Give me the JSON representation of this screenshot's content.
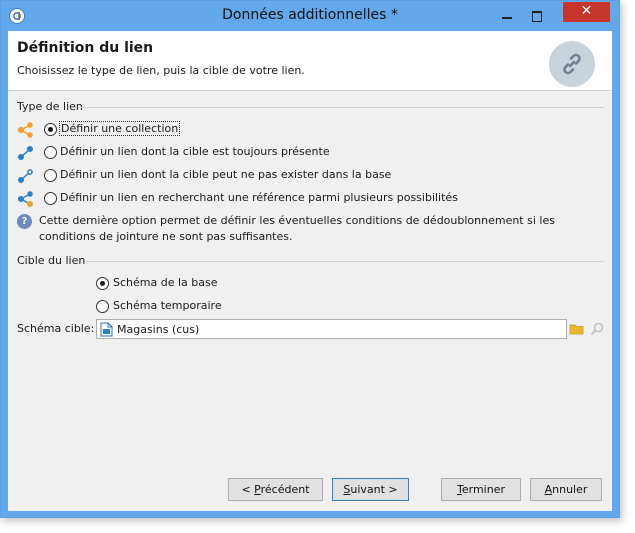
{
  "window": {
    "title": "Données additionnelles *",
    "close_glyph": "✕"
  },
  "header": {
    "title": "Définition du lien",
    "subtitle": "Choisissez le type de lien, puis la cible de votre lien.",
    "badge_icon": "link-icon"
  },
  "link_type": {
    "section_label": "Type de lien",
    "options": [
      {
        "label": "Définir une collection",
        "selected": true,
        "icon": "collection-link-icon",
        "icon_color": "#f0a030"
      },
      {
        "label": "Définir un lien dont la cible est toujours présente",
        "selected": false,
        "icon": "simple-link-icon",
        "icon_color": "#2f7ec8"
      },
      {
        "label": "Définir un lien dont la cible peut ne pas exister dans la base",
        "selected": false,
        "icon": "optional-link-icon",
        "icon_color": "#2f7ec8"
      },
      {
        "label": "Définir un lien en recherchant une référence parmi plusieurs possibilités",
        "selected": false,
        "icon": "multi-link-icon",
        "icon_color": "#2f7ec8"
      }
    ],
    "info": "Cette dernière option permet de définir les éventuelles conditions de dédoublonnement si les conditions de jointure ne sont pas suffisantes."
  },
  "target": {
    "section_label": "Cible du lien",
    "options": [
      {
        "label": "Schéma de la base",
        "selected": true
      },
      {
        "label": "Schéma temporaire",
        "selected": false
      }
    ],
    "schema_label": "Schéma cible:",
    "schema_value": "Magasins (cus)"
  },
  "buttons": {
    "previous": {
      "prefix": "< ",
      "mnemonic": "P",
      "rest": "récédent"
    },
    "next": {
      "prefix": "",
      "mnemonic": "S",
      "rest": "uivant >"
    },
    "finish": {
      "prefix": "",
      "mnemonic": "T",
      "rest": "erminer"
    },
    "cancel": {
      "prefix": "",
      "mnemonic": "A",
      "rest": "nnuler"
    }
  },
  "colors": {
    "titlebar": "#62a8ea",
    "close_button": "#c7352b",
    "accent_orange": "#f0a030",
    "accent_blue": "#2f7ec8",
    "folder": "#e8b830"
  }
}
